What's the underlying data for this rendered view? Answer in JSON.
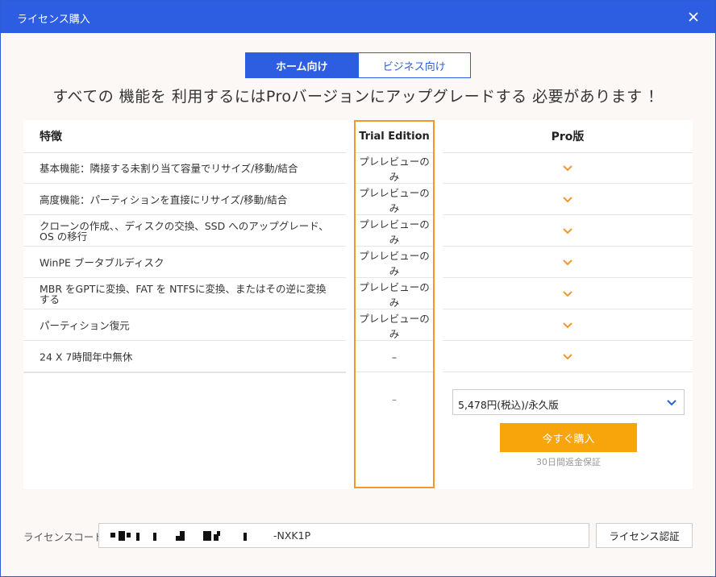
{
  "window": {
    "title": "ライセンス購入",
    "close_icon": "close-icon"
  },
  "tabs": [
    {
      "label": "ホーム向け",
      "active": true
    },
    {
      "label": "ビジネス向け",
      "active": false
    }
  ],
  "headline": "すべての 機能を 利用するにはProバージョンにアップグレードする 必要があります ！",
  "table": {
    "headers": {
      "feature": "特徴",
      "trial": "Trial Edition",
      "pro": "Pro版"
    },
    "rows": [
      {
        "feature": "基本機能：隣接する未割り当て容量でリサイズ/移動/結合",
        "trial": "プレレビューのみ",
        "pro": "check-icon"
      },
      {
        "feature": "高度機能：パーティションを直接にリサイズ/移動/結合",
        "trial": "プレレビューのみ",
        "pro": "check-icon"
      },
      {
        "feature": "クローンの作成、、ディスクの交換、SSD へのアップグレード、OS の移行",
        "trial": "プレレビューのみ",
        "pro": "check-icon"
      },
      {
        "feature": "WinPE ブータブルディスク",
        "trial": "プレレビューのみ",
        "pro": "check-icon"
      },
      {
        "feature": "MBR をGPTに変換、FAT を NTFSに変換、またはその逆に変換する",
        "trial": "プレレビューのみ",
        "pro": "check-icon"
      },
      {
        "feature": "パーティション復元",
        "trial": "プレレビューのみ",
        "pro": "check-icon"
      },
      {
        "feature": "24 X 7時間年中無休",
        "trial": "–",
        "pro": "check-icon"
      }
    ],
    "trial_bottom": "–"
  },
  "purchase": {
    "price_option": "5,478円(税込)/永久版",
    "buy_label": "今すぐ購入",
    "guarantee": "30日間返金保証"
  },
  "license": {
    "label": "ライセンスコード",
    "code_suffix": "-NXK1P",
    "verify_label": "ライセンス認証"
  },
  "colors": {
    "accent_blue": "#2d5de0",
    "check_orange": "#f5962a",
    "buy_orange": "#f8a50c",
    "highlight_orange": "#f5962a"
  }
}
